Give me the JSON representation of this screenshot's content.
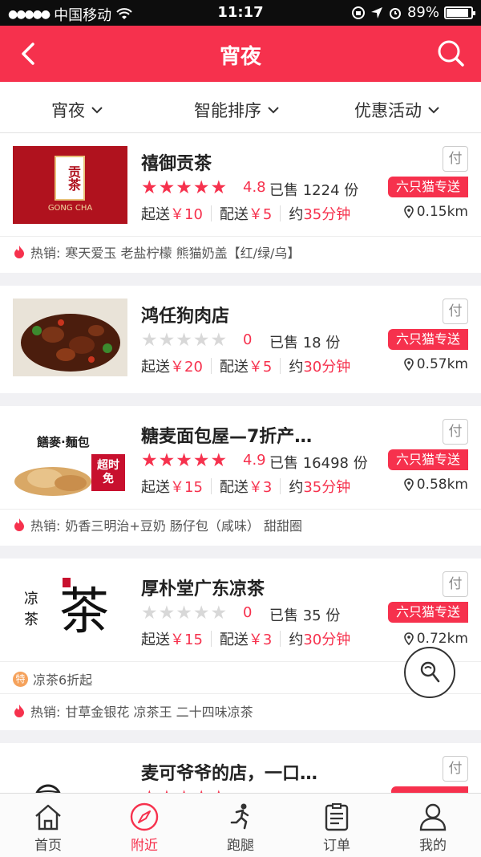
{
  "status_bar": {
    "carrier": "中国移动",
    "time": "11:17",
    "battery": "89%"
  },
  "header": {
    "title": "宵夜"
  },
  "filters": [
    {
      "label": "宵夜"
    },
    {
      "label": "智能排序"
    },
    {
      "label": "优惠活动"
    }
  ],
  "colors": {
    "brand": "#f6314d",
    "star_empty": "#d8d8d8"
  },
  "stores": [
    {
      "name": "禧御贡茶",
      "pay": "付",
      "rating": "4.8",
      "stars_filled": 5,
      "sold": "已售 1224 份",
      "delivery_tag": "六只猫专送",
      "min_label": "起送",
      "min_value": "￥10",
      "fee_label": "配送",
      "fee_value": "￥5",
      "time_prefix": "约",
      "time_value": "35分钟",
      "distance": "0.15km",
      "hot_label": "热销:",
      "hot_items": "寒天爱玉 老盐柠檬 熊猫奶盖【红/绿/乌】",
      "thumb_text": {
        "big": "贡茶",
        "small": "GONG CHA"
      }
    },
    {
      "name": "鸿任狗肉店",
      "pay": "付",
      "rating": "0",
      "stars_filled": 0,
      "sold": "已售 18 份",
      "delivery_tag": "六只猫专送",
      "min_label": "起送",
      "min_value": "￥20",
      "fee_label": "配送",
      "fee_value": "￥5",
      "time_prefix": "约",
      "time_value": "30分钟",
      "distance": "0.57km"
    },
    {
      "name": "糖麦面包屋—7折产…",
      "pay": "付",
      "rating": "4.9",
      "stars_filled": 5,
      "sold": "已售 16498 份",
      "delivery_tag": "六只猫专送",
      "min_label": "起送",
      "min_value": "￥15",
      "fee_label": "配送",
      "fee_value": "￥3",
      "time_prefix": "约",
      "time_value": "35分钟",
      "distance": "0.58km",
      "hot_label": "热销:",
      "hot_items": "奶香三明治+豆奶 肠仔包（咸味） 甜甜圈",
      "thumb_text": {
        "big": "饍麥·麵包",
        "small": "超时免"
      }
    },
    {
      "name": "厚朴堂广东凉茶",
      "pay": "付",
      "rating": "0",
      "stars_filled": 0,
      "sold": "已售 35 份",
      "delivery_tag": "六只猫专送",
      "min_label": "起送",
      "min_value": "￥15",
      "fee_label": "配送",
      "fee_value": "￥3",
      "time_prefix": "约",
      "time_value": "30分钟",
      "distance": "0.72km",
      "promo_badge": "特",
      "promo": "凉茶6折起",
      "hot_label": "热销:",
      "hot_items": "甘草金银花 凉茶王 二十四味凉茶",
      "thumb_text": {
        "big": "茶",
        "small": "凉茶"
      }
    },
    {
      "name": "麦可爷爷的店，一口…",
      "pay": "付"
    }
  ],
  "tabbar": [
    {
      "label": "首页",
      "icon": "home-icon"
    },
    {
      "label": "附近",
      "icon": "compass-icon"
    },
    {
      "label": "跑腿",
      "icon": "runner-icon"
    },
    {
      "label": "订单",
      "icon": "order-icon"
    },
    {
      "label": "我的",
      "icon": "user-icon"
    }
  ]
}
